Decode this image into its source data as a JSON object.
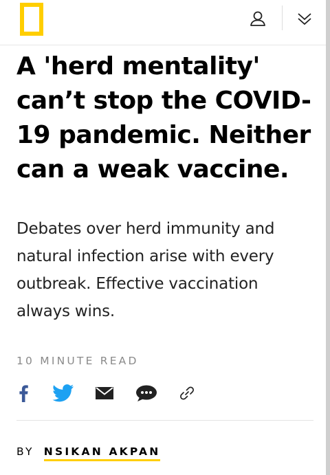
{
  "header": {
    "logo_color": "#FFCE00",
    "user_icon": "user-icon",
    "menu_icon": "chevron-double-down-icon"
  },
  "article": {
    "headline": "A 'herd mentality' can’t stop the COVID-19 pandemic. Neither can a weak vaccine.",
    "dek": "Debates over herd immunity and natural infection arise with every outbreak. Effective vaccination always wins.",
    "read_time": "10 MINUTE READ"
  },
  "share": {
    "facebook_icon": "facebook-icon",
    "twitter_icon": "twitter-icon",
    "email_icon": "email-icon",
    "comment_icon": "comment-icon",
    "link_icon": "link-icon",
    "facebook_color": "#3b5998",
    "twitter_color": "#1da1f2"
  },
  "byline": {
    "prefix": "BY",
    "author": "NSIKAN AKPAN",
    "underline_color": "#FFCE00"
  }
}
